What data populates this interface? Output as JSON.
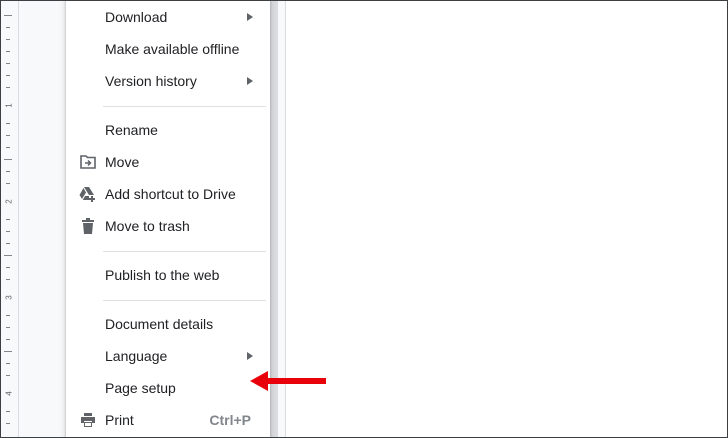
{
  "menu": {
    "items": [
      {
        "id": "download",
        "label": "Download",
        "submenu": true,
        "icon": null
      },
      {
        "id": "offline",
        "label": "Make available offline",
        "submenu": false,
        "icon": null
      },
      {
        "id": "version-history",
        "label": "Version history",
        "submenu": true,
        "icon": null
      },
      {
        "id": "rename",
        "label": "Rename",
        "submenu": false,
        "icon": null
      },
      {
        "id": "move",
        "label": "Move",
        "submenu": false,
        "icon": "folder-move-icon"
      },
      {
        "id": "add-shortcut",
        "label": "Add shortcut to Drive",
        "submenu": false,
        "icon": "drive-add-icon"
      },
      {
        "id": "trash",
        "label": "Move to trash",
        "submenu": false,
        "icon": "trash-icon"
      },
      {
        "id": "publish",
        "label": "Publish to the web",
        "submenu": false,
        "icon": null
      },
      {
        "id": "details",
        "label": "Document details",
        "submenu": false,
        "icon": null
      },
      {
        "id": "language",
        "label": "Language",
        "submenu": true,
        "icon": null
      },
      {
        "id": "page-setup",
        "label": "Page setup",
        "submenu": false,
        "icon": null
      },
      {
        "id": "print",
        "label": "Print",
        "submenu": false,
        "icon": "printer-icon",
        "shortcut": "Ctrl+P"
      }
    ]
  },
  "ruler": {
    "numbers": [
      "1",
      "2",
      "3",
      "4"
    ]
  },
  "annotation": {
    "arrow_color": "#e8000b",
    "target": "Page setup"
  },
  "colors": {
    "menu_bg": "#ffffff",
    "text": "#202124",
    "icon": "#5f6368",
    "separator": "#e0e0e0"
  }
}
